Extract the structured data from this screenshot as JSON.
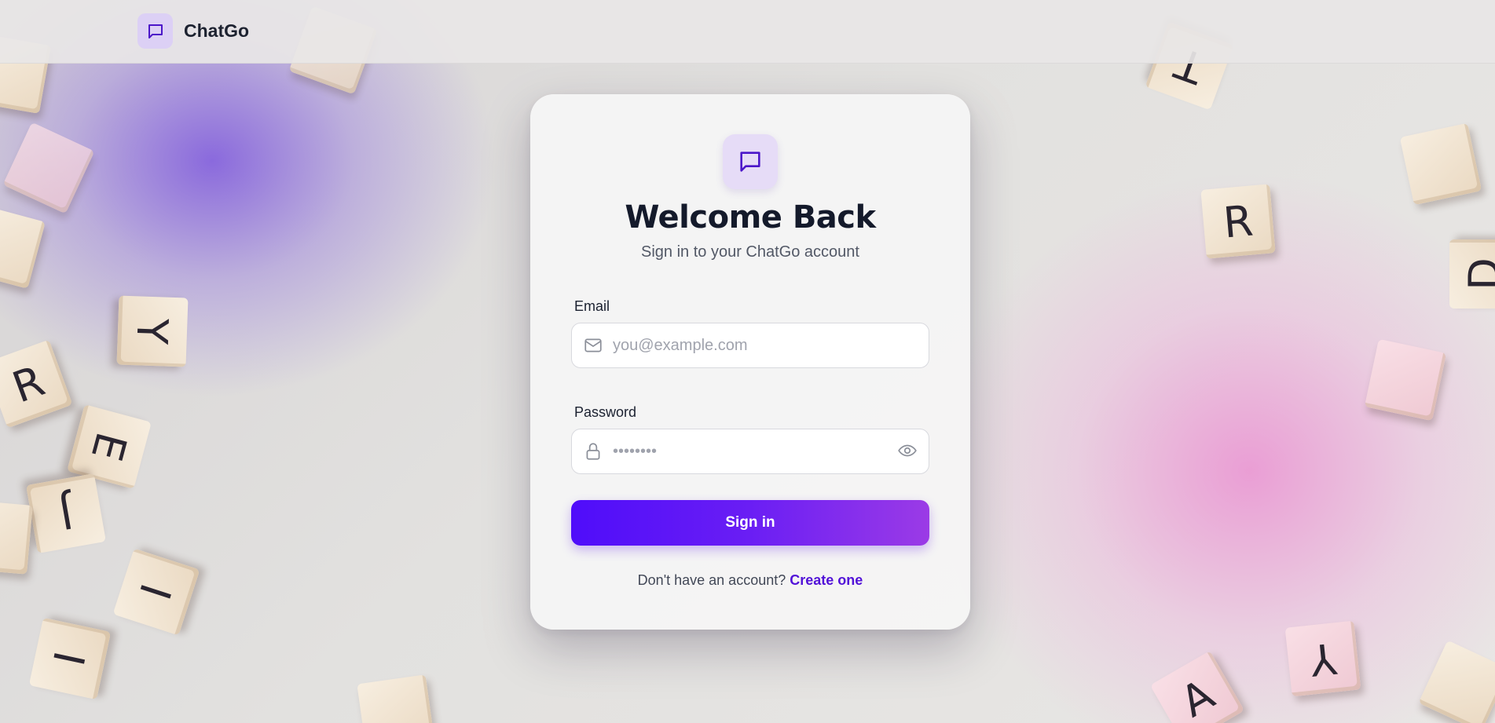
{
  "header": {
    "brand_name": "ChatGo",
    "brand_icon": "chat-bubble-icon"
  },
  "login": {
    "icon": "chat-bubble-icon",
    "title": "Welcome Back",
    "subtitle": "Sign in to your ChatGo account",
    "email": {
      "label": "Email",
      "placeholder": "you@example.com",
      "value": "",
      "icon": "mail-icon"
    },
    "password": {
      "label": "Password",
      "placeholder": "••••••••",
      "value": "",
      "icon": "lock-icon",
      "toggle_icon": "eye-icon"
    },
    "submit_label": "Sign in",
    "footer_prompt": "Don't have an account?",
    "footer_link": "Create one"
  },
  "background_tiles": [
    "R",
    "E",
    "J",
    "Y",
    "I",
    "I",
    "R",
    "T",
    "Y",
    "A",
    "D"
  ],
  "colors": {
    "accent": "#5212d8",
    "button_start": "#4f0dfa",
    "button_end": "#9b3be6",
    "icon_box": "#e6dcf7",
    "title": "#141a2b"
  }
}
